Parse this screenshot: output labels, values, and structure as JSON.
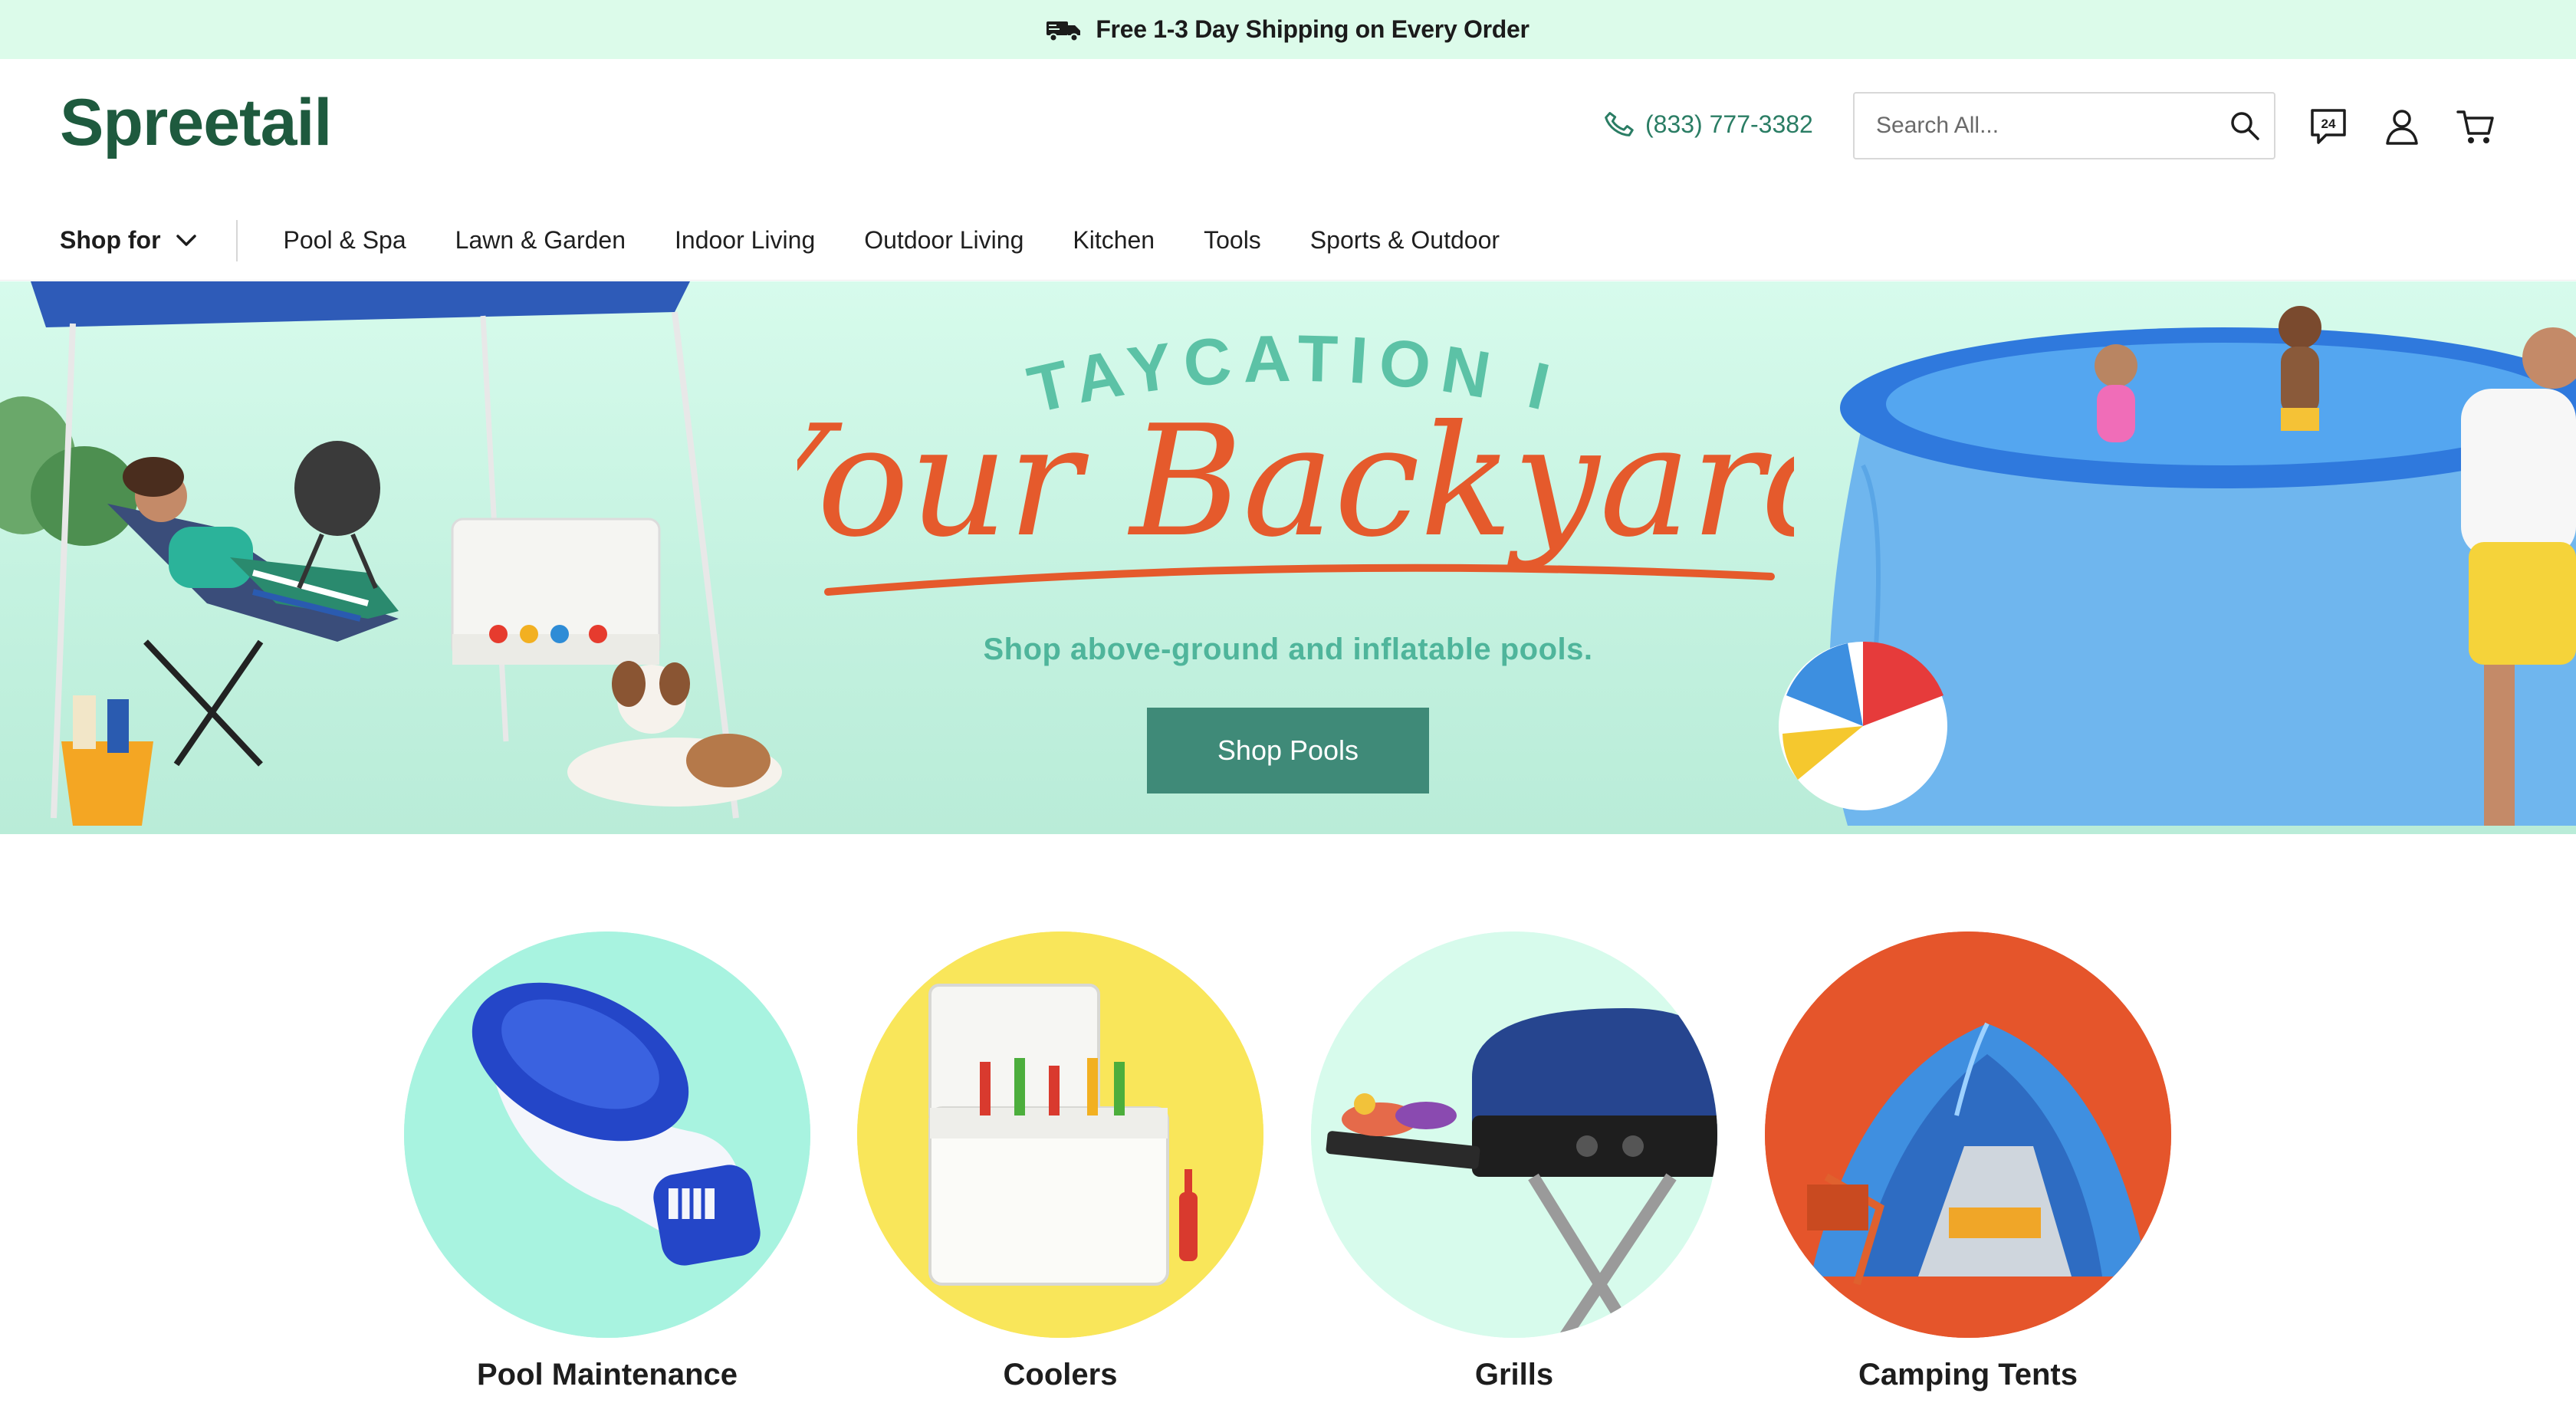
{
  "announcement": {
    "text": "Free 1-3 Day Shipping on Every Order",
    "icon": "truck-icon"
  },
  "header": {
    "logo": "Spreetail",
    "phone": "(833) 777-3382",
    "search_placeholder": "Search All...",
    "icons": [
      "search-icon",
      "chat-24-icon",
      "account-icon",
      "cart-icon"
    ]
  },
  "nav": {
    "shop_for": "Shop for",
    "links": [
      "Pool & Spa",
      "Lawn & Garden",
      "Indoor Living",
      "Outdoor Living",
      "Kitchen",
      "Tools",
      "Sports & Outdoor"
    ]
  },
  "hero": {
    "kicker": "STAYCATION IN",
    "headline": "Your Backyard",
    "subtitle": "Shop above-ground and inflatable pools.",
    "cta": "Shop Pools"
  },
  "categories": [
    {
      "label": "Pool Maintenance",
      "bg": "#a8f3e0"
    },
    {
      "label": "Coolers",
      "bg": "#f9e65a"
    },
    {
      "label": "Grills",
      "bg": "#d7fbec"
    },
    {
      "label": "Camping Tents",
      "bg": "#e5552b"
    }
  ],
  "colors": {
    "brand": "#1e5a3e",
    "accent": "#3f8a78",
    "banner": "#dcfbea",
    "script": "#e55a2c"
  }
}
